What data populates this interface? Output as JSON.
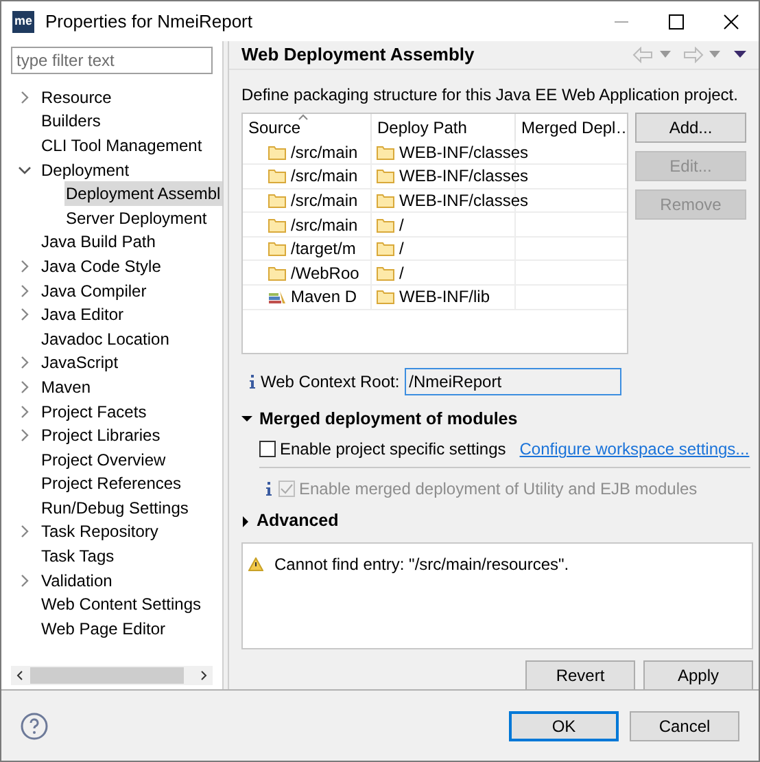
{
  "window": {
    "app_icon": "me",
    "title": "Properties for NmeiReport"
  },
  "filter": {
    "placeholder": "type filter text"
  },
  "tree": [
    {
      "label": "Resource",
      "kind": "group",
      "expanded": false,
      "selected": false
    },
    {
      "label": "Builders",
      "kind": "leaf",
      "selected": false
    },
    {
      "label": "CLI Tool Management",
      "kind": "leaf",
      "selected": false
    },
    {
      "label": "Deployment",
      "kind": "group",
      "expanded": true,
      "selected": false,
      "children": [
        {
          "label": "Deployment Assembl",
          "kind": "leaf",
          "selected": true
        },
        {
          "label": "Server Deployment",
          "kind": "leaf",
          "selected": false
        }
      ]
    },
    {
      "label": "Java Build Path",
      "kind": "leaf",
      "selected": false
    },
    {
      "label": "Java Code Style",
      "kind": "group",
      "expanded": false,
      "selected": false
    },
    {
      "label": "Java Compiler",
      "kind": "group",
      "expanded": false,
      "selected": false
    },
    {
      "label": "Java Editor",
      "kind": "group",
      "expanded": false,
      "selected": false
    },
    {
      "label": "Javadoc Location",
      "kind": "leaf",
      "selected": false
    },
    {
      "label": "JavaScript",
      "kind": "group",
      "expanded": false,
      "selected": false
    },
    {
      "label": "Maven",
      "kind": "group",
      "expanded": false,
      "selected": false
    },
    {
      "label": "Project Facets",
      "kind": "group",
      "expanded": false,
      "selected": false
    },
    {
      "label": "Project Libraries",
      "kind": "group",
      "expanded": false,
      "selected": false
    },
    {
      "label": "Project Overview",
      "kind": "leaf",
      "selected": false
    },
    {
      "label": "Project References",
      "kind": "leaf",
      "selected": false
    },
    {
      "label": "Run/Debug Settings",
      "kind": "leaf",
      "selected": false
    },
    {
      "label": "Task Repository",
      "kind": "group",
      "expanded": false,
      "selected": false
    },
    {
      "label": "Task Tags",
      "kind": "leaf",
      "selected": false
    },
    {
      "label": "Validation",
      "kind": "group",
      "expanded": false,
      "selected": false
    },
    {
      "label": "Web Content Settings",
      "kind": "leaf",
      "selected": false
    },
    {
      "label": "Web Page Editor",
      "kind": "leaf",
      "selected": false
    }
  ],
  "page": {
    "title": "Web Deployment Assembly",
    "description": "Define packaging structure for this Java EE Web Application project."
  },
  "table": {
    "columns": [
      "Source",
      "Deploy Path",
      "Merged Depl…"
    ],
    "rows": [
      {
        "kind": "folder",
        "source": "/src/main",
        "deploy_path": "WEB-INF/classes"
      },
      {
        "kind": "folder",
        "source": "/src/main",
        "deploy_path": "WEB-INF/classes"
      },
      {
        "kind": "folder",
        "source": "/src/main",
        "deploy_path": "WEB-INF/classes"
      },
      {
        "kind": "folder",
        "source": "/src/main",
        "deploy_path": "/"
      },
      {
        "kind": "folder",
        "source": "/target/m",
        "deploy_path": "/"
      },
      {
        "kind": "folder",
        "source": "/WebRoo",
        "deploy_path": "/"
      },
      {
        "kind": "library",
        "source": "Maven D",
        "deploy_path": "WEB-INF/lib"
      }
    ]
  },
  "side_buttons": [
    {
      "label": "Add...",
      "disabled": false
    },
    {
      "label": "Edit...",
      "disabled": true
    },
    {
      "label": "Remove",
      "disabled": true
    }
  ],
  "context_root": {
    "label": "Web Context Root:",
    "value": "/NmeiReport"
  },
  "merged": {
    "title": "Merged deployment of modules",
    "expanded": true,
    "project_specific": {
      "label": "Enable project specific settings",
      "checked": false
    },
    "link": "Configure workspace settings...",
    "merge_option": {
      "label": "Enable merged deployment of Utility and EJB modules",
      "checked": true,
      "disabled": true
    }
  },
  "advanced": {
    "title": "Advanced",
    "expanded": false
  },
  "messages": [
    "Cannot find entry: \"/src/main/resources\"."
  ],
  "page_buttons": [
    "Revert",
    "Apply"
  ],
  "dialog_buttons": [
    {
      "label": "OK",
      "default": true
    },
    {
      "label": "Cancel",
      "default": false
    }
  ]
}
